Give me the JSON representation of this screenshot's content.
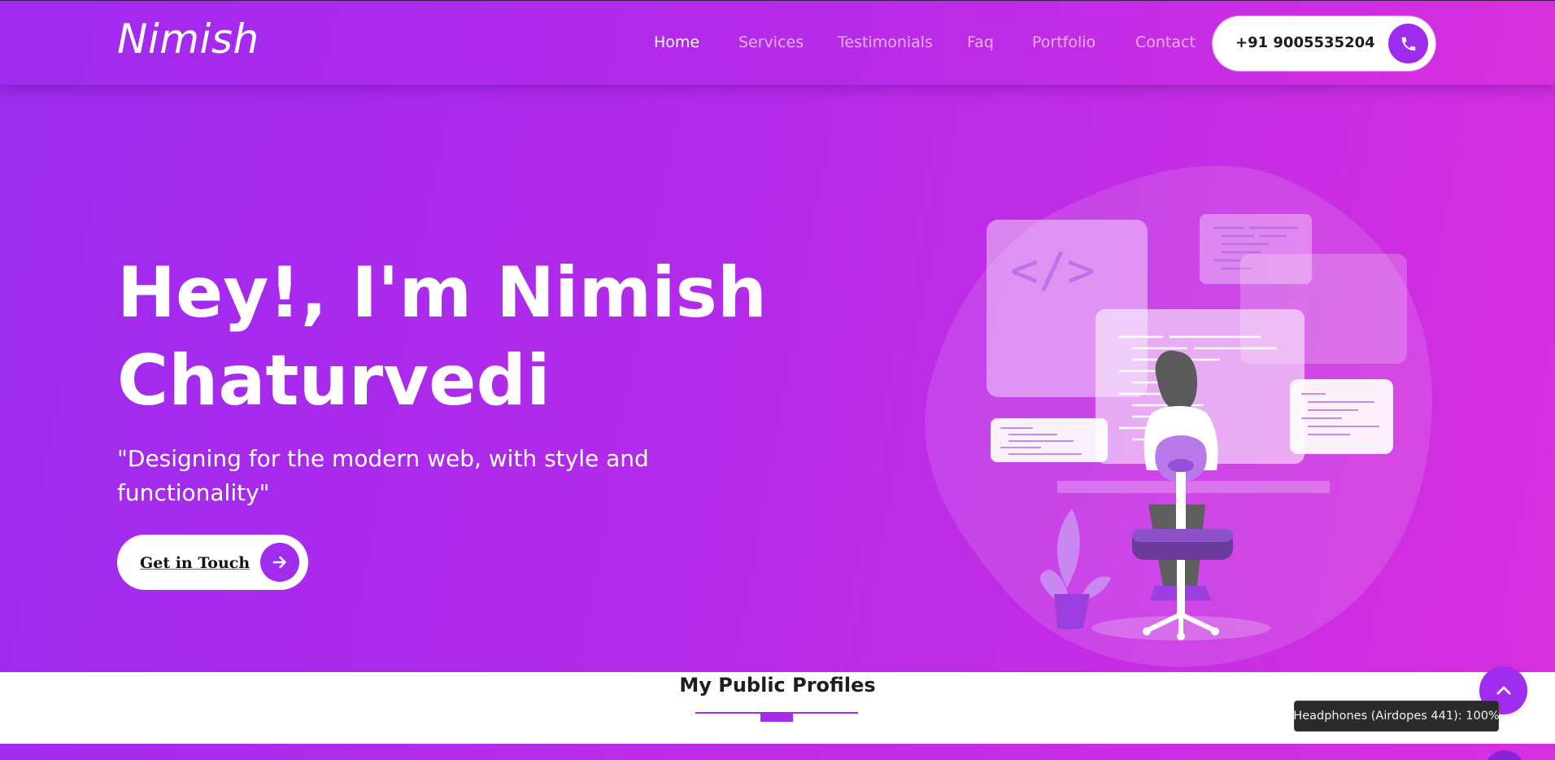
{
  "brand": {
    "name": "Nimish"
  },
  "nav": {
    "items": [
      {
        "label": "Home",
        "active": true
      },
      {
        "label": "Services",
        "active": false
      },
      {
        "label": "Testimonials",
        "active": false
      },
      {
        "label": "Faq",
        "active": false
      },
      {
        "label": "Portfolio",
        "active": false
      },
      {
        "label": "Contact",
        "active": false
      }
    ],
    "phone": "+91 9005535204",
    "phone_icon": "phone-icon"
  },
  "hero": {
    "title_line1": "Hey!, I'm Nimish",
    "title_line2": "Chaturvedi",
    "subtitle": "\"Designing for the modern web, with style and functionality\"",
    "cta_label": "Get in Touch",
    "cta_icon": "arrow-right-icon",
    "illustration_code_tag": "</>"
  },
  "profiles": {
    "title": "My Public Profiles"
  },
  "overlay": {
    "tooltip": "Headphones (Airdopes 441): 100%",
    "scroll_top_icon": "chevron-up-icon"
  },
  "colors": {
    "accent": "#9f2bef",
    "gradient_start": "#9d2bef",
    "gradient_end": "#d62fdf",
    "white": "#ffffff"
  }
}
